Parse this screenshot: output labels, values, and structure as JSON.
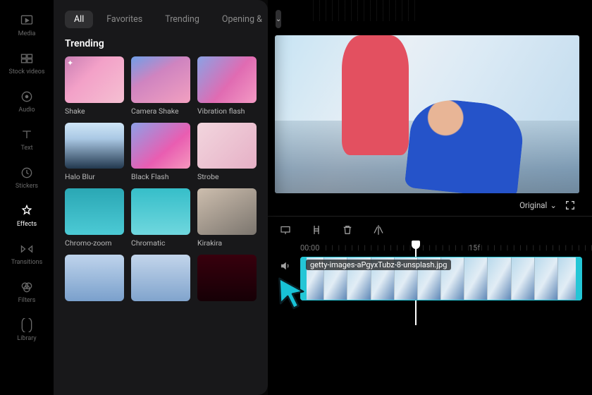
{
  "sidebar": {
    "items": [
      {
        "label": "Media"
      },
      {
        "label": "Stock videos"
      },
      {
        "label": "Audio"
      },
      {
        "label": "Text"
      },
      {
        "label": "Stickers"
      },
      {
        "label": "Effects"
      },
      {
        "label": "Transitions"
      },
      {
        "label": "Filters"
      },
      {
        "label": "Library"
      }
    ]
  },
  "panel": {
    "tabs": {
      "all": "All",
      "favorites": "Favorites",
      "trending": "Trending",
      "opening": "Opening &"
    },
    "section_title": "Trending",
    "effects": [
      {
        "label": "Shake"
      },
      {
        "label": "Camera Shake"
      },
      {
        "label": "Vibration flash"
      },
      {
        "label": "Halo Blur"
      },
      {
        "label": "Black Flash"
      },
      {
        "label": "Strobe"
      },
      {
        "label": "Chromo-zoom"
      },
      {
        "label": "Chromatic"
      },
      {
        "label": "Kirakira"
      }
    ]
  },
  "preview": {
    "zoom_label": "Original"
  },
  "timeline": {
    "ruler": {
      "start": "00:00",
      "mid": "15f"
    },
    "clip_name": "getty-images-aPgyxTubz-8-unsplash.jpg"
  }
}
